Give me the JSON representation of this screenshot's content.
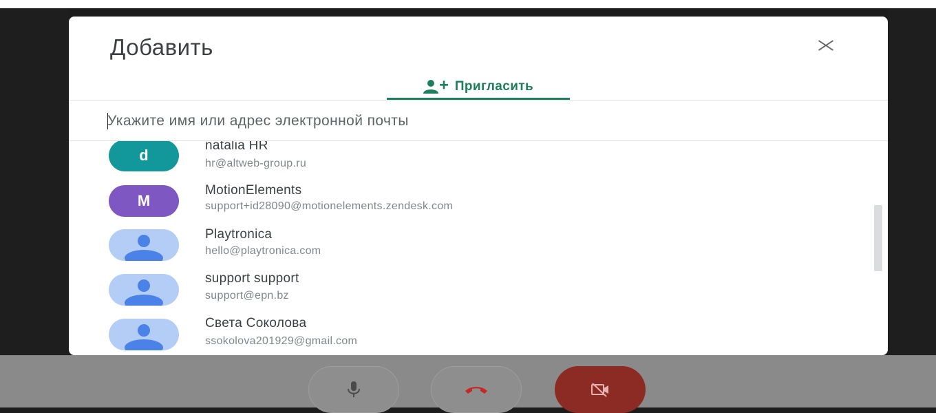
{
  "dialog": {
    "title": "Добавить",
    "close_icon": "close-icon"
  },
  "tab": {
    "label": "Пригласить",
    "icon": "person-add-icon",
    "color": "#1e7f5c"
  },
  "search": {
    "placeholder": "Укажите имя или адрес электронной почты",
    "value": ""
  },
  "contacts": [
    {
      "name": "natalia HR",
      "email": "hr@altweb-group.ru",
      "avatar_letter": "d",
      "avatar_color": "#12979a"
    },
    {
      "name": "MotionElements",
      "email": "support+id28090@motionelements.zendesk.com",
      "avatar_letter": "M",
      "avatar_color": "#7e57c2"
    },
    {
      "name": "Playtronica",
      "email": "hello@playtronica.com",
      "avatar_icon": "person-icon"
    },
    {
      "name": "support support",
      "email": "support@epn.bz",
      "avatar_icon": "person-icon"
    },
    {
      "name": "Света Соколова",
      "email": "ssokolova201929@gmail.com",
      "avatar_icon": "person-icon"
    }
  ],
  "controls": {
    "mic_icon": "microphone-icon",
    "hangup_icon": "hang-up-icon",
    "video_icon": "video-off-icon",
    "hangup_color": "#d93025",
    "video_bg": "#8c2a24"
  }
}
